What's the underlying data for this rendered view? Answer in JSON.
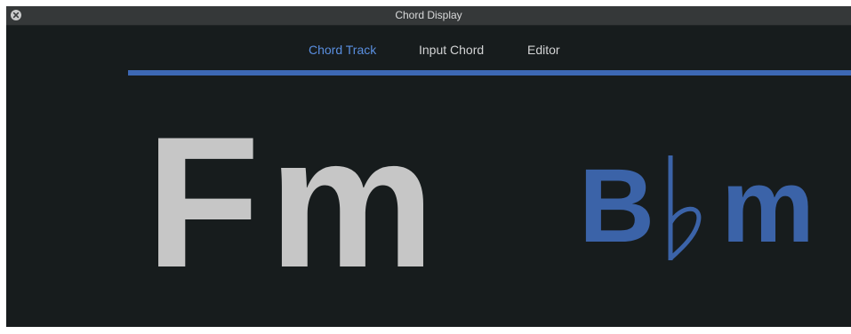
{
  "window": {
    "title": "Chord Display",
    "close_icon": "close-icon"
  },
  "tabs": [
    {
      "label": "Chord Track",
      "active": true
    },
    {
      "label": "Input Chord",
      "active": false
    },
    {
      "label": "Editor",
      "active": false
    }
  ],
  "progress": {
    "fraction": 1.0
  },
  "display": {
    "current_chord": "Fm",
    "next_chord": {
      "root": "B",
      "accidental_icon": "flat-icon",
      "quality": "m"
    }
  },
  "colors": {
    "accent": "#3d68b4",
    "active_tab": "#5a8fe0",
    "current_chord": "#c6c6c6",
    "next_chord": "#3b63a8",
    "background": "#171c1d",
    "titlebar": "#353839"
  }
}
